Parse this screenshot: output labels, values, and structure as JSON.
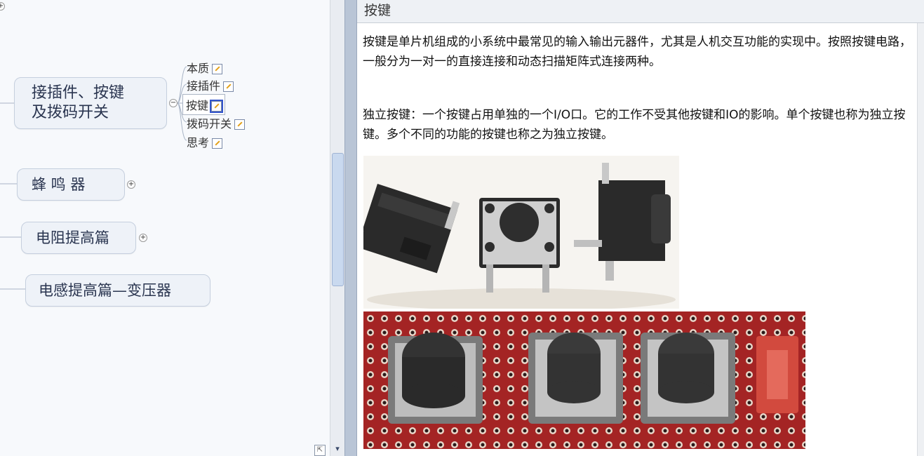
{
  "mindmap": {
    "main_node": {
      "line1": "接插件、按键",
      "line2": "及拨码开关"
    },
    "subtopics": [
      {
        "label": "本质"
      },
      {
        "label": "接插件"
      },
      {
        "label": "按键"
      },
      {
        "label": "拨码开关"
      },
      {
        "label": "思考"
      }
    ],
    "nodes": [
      {
        "label": "蜂 鸣 器"
      },
      {
        "label": "电阻提高篇"
      },
      {
        "label": "电感提高篇—变压器"
      }
    ],
    "collapse_symbol": "−",
    "expand_symbol": "+"
  },
  "notes": {
    "title": "按键",
    "paragraph1": "按键是单片机组成的小系统中最常见的输入输出元器件，尤其是人机交互功能的实现中。按照按键电路，一般分为一对一的直接连接和动态扫描矩阵式连接两种。",
    "paragraph2": "独立按键：一个按键占用单独的一个I/O口。它的工作不受其他按键和IO的影响。单个按键也称为独立按键。多个不同的功能的按键也称之为独立按键。"
  },
  "colors": {
    "selection": "#3355cc",
    "accent_pcb": "#a42424"
  }
}
